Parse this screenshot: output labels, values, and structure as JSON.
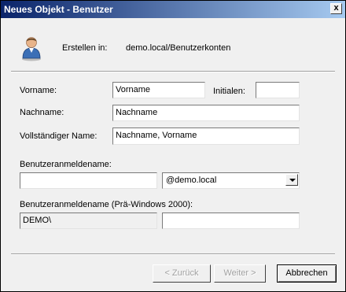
{
  "window": {
    "title": "Neues Objekt - Benutzer",
    "close_glyph": "x"
  },
  "header": {
    "icon": "user-icon",
    "create_in_label": "Erstellen in:",
    "create_in_value": "demo.local/Benutzerkonten"
  },
  "form": {
    "first_name_label": "Vorname:",
    "first_name_value": "Vorname",
    "initials_label": "Initialen:",
    "initials_value": "",
    "last_name_label": "Nachname:",
    "last_name_value": "Nachname",
    "full_name_label": "Vollständiger Name:",
    "full_name_value": "Nachname, Vorname",
    "logon_name_label": "Benutzeranmeldename:",
    "logon_name_value": "",
    "domain_suffix_value": "@demo.local",
    "pre2000_label": "Benutzeranmeldename (Prä-Windows 2000):",
    "pre2000_domain_value": "DEMO\\",
    "pre2000_name_value": ""
  },
  "buttons": {
    "back_label": "< Zurück",
    "next_label": "Weiter >",
    "cancel_label": "Abbrechen"
  },
  "colors": {
    "title_bar": "#0a246a",
    "dialog_bg": "#f0f0f0",
    "icon_body": "#3b6fb6",
    "icon_skin": "#e8b48a"
  }
}
